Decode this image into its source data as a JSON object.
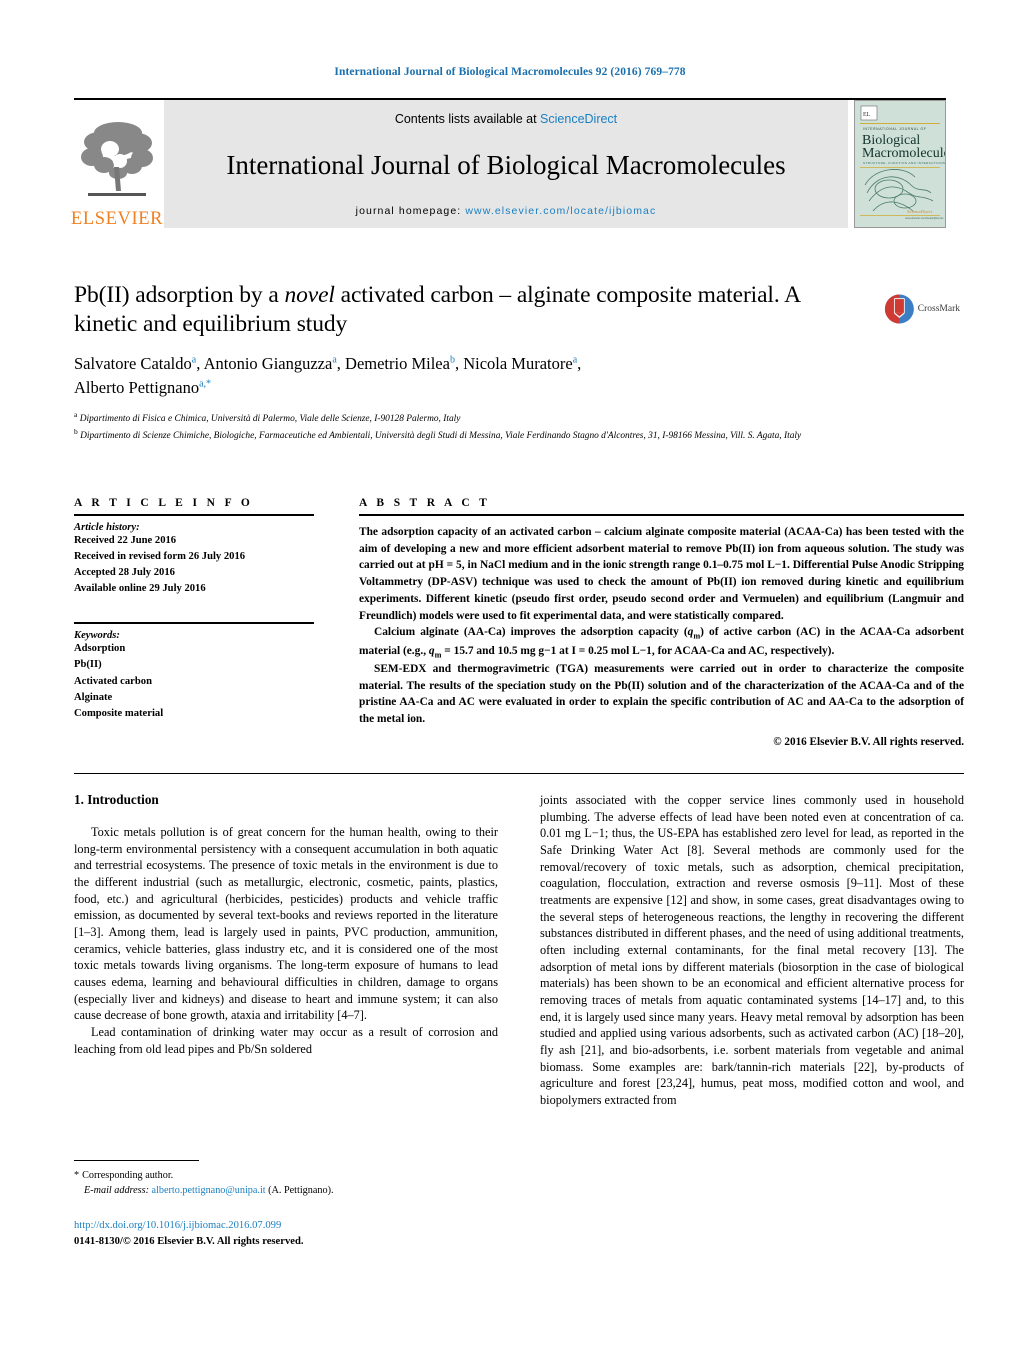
{
  "running_head": "International Journal of Biological Macromolecules 92 (2016) 769–778",
  "masthead": {
    "contents_prefix": "Contents lists available at ",
    "contents_link": "ScienceDirect",
    "journal_title": "International Journal of Biological Macromolecules",
    "homepage_prefix": "journal homepage: ",
    "homepage_url": "www.elsevier.com/locate/ijbiomac",
    "publisher_name": "ELSEVIER",
    "cover_line1": "INTERNATIONAL JOURNAL OF",
    "cover_line2": "Biological",
    "cover_line3": "Macromolecules",
    "cover_line4": "STRUCTURE, FUNCTION AND INTERACTIONS",
    "cover_footer": "ScienceDirect",
    "cover_footer_sub": "www.elsevier.com/locate/ijbiomac"
  },
  "article": {
    "title_part1": "Pb(II) adsorption by a ",
    "title_italic": "novel",
    "title_part2": " activated carbon – alginate composite material. A kinetic and equilibrium study",
    "authors": [
      {
        "name": "Salvatore Cataldo",
        "sup": "a"
      },
      {
        "name": "Antonio Gianguzza",
        "sup": "a"
      },
      {
        "name": "Demetrio Milea",
        "sup": "b"
      },
      {
        "name": "Nicola Muratore",
        "sup": "a"
      },
      {
        "name": "Alberto Pettignano",
        "sup": "a,*"
      }
    ],
    "affiliations": [
      {
        "marker": "a",
        "text": "Dipartimento di Fisica e Chimica, Università di Palermo, Viale delle Scienze, I-90128 Palermo, Italy"
      },
      {
        "marker": "b",
        "text": "Dipartimento di Scienze Chimiche, Biologiche, Farmaceutiche ed Ambientali, Università degli Studi di Messina, Viale Ferdinando Stagno d'Alcontres, 31, I-98166 Messina, Vill. S. Agata, Italy"
      }
    ],
    "crossmark_label": "CrossMark"
  },
  "article_info": {
    "heading": "A R T I C L E    I N F O",
    "history_title": "Article history:",
    "history": [
      "Received 22 June 2016",
      "Received in revised form 26 July 2016",
      "Accepted 28 July 2016",
      "Available online 29 July 2016"
    ],
    "keywords_title": "Keywords:",
    "keywords": [
      "Adsorption",
      "Pb(II)",
      "Activated carbon",
      "Alginate",
      "Composite material"
    ]
  },
  "abstract": {
    "heading": "A B S T R A C T",
    "paragraph1": "The adsorption capacity of an activated carbon – calcium alginate composite material (ACAA-Ca) has been tested with the aim of developing a new and more efficient adsorbent material to remove Pb(II) ion from aqueous solution. The study was carried out at pH = 5, in NaCl medium and in the ionic strength range 0.1–0.75 mol L−1. Differential Pulse Anodic Stripping Voltammetry (DP-ASV) technique was used to check the amount of Pb(II) ion removed during kinetic and equilibrium experiments. Different kinetic (pseudo first order, pseudo second order and Vermuelen) and equilibrium (Langmuir and Freundlich) models were used to fit experimental data, and were statistically compared.",
    "paragraph2_a": "Calcium alginate (AA-Ca) improves the adsorption capacity (",
    "paragraph2_qm": "q",
    "paragraph2_qm_sub": "m",
    "paragraph2_b": ") of active carbon (AC) in the ACAA-Ca adsorbent material (e.g., ",
    "paragraph2_c": " = 15.7 and 10.5 mg g−1 at I = 0.25 mol L−1, for ACAA-Ca and AC, respectively).",
    "paragraph3": "SEM-EDX and thermogravimetric (TGA) measurements were carried out in order to characterize the composite material. The results of the speciation study on the Pb(II) solution and of the characterization of the ACAA-Ca and of the pristine AA-Ca and AC were evaluated in order to explain the specific contribution of AC and AA-Ca to the adsorption of the metal ion.",
    "copyright": "© 2016 Elsevier B.V. All rights reserved."
  },
  "introduction": {
    "heading": "1.  Introduction",
    "left_paragraphs": [
      "Toxic metals pollution is of great concern for the human health, owing to their long-term environmental persistency with a consequent accumulation in both aquatic and terrestrial ecosystems. The presence of toxic metals in the environment is due to the different industrial (such as metallurgic, electronic, cosmetic, paints, plastics, food, etc.) and agricultural (herbicides, pesticides) products and vehicle traffic emission, as documented by several text-books and reviews reported in the literature [1–3]. Among them, lead is largely used in paints, PVC production, ammunition, ceramics, vehicle batteries, glass industry etc, and it is considered one of the most toxic metals towards living organisms. The long-term exposure of humans to lead causes edema, learning and behavioural difficulties in children, damage to organs (especially liver and kidneys) and disease to heart and immune system; it can also cause decrease of bone growth, ataxia and irritability [4–7].",
      "Lead contamination of drinking water may occur as a result of corrosion and leaching from old lead pipes and Pb/Sn soldered"
    ],
    "right_paragraphs": [
      "joints associated with the copper service lines commonly used in household plumbing. The adverse effects of lead have been noted even at concentration of ca. 0.01 mg L−1; thus, the US-EPA has established zero level for lead, as reported in the Safe Drinking Water Act [8]. Several methods are commonly used for the removal/recovery of toxic metals, such as adsorption, chemical precipitation, coagulation, flocculation, extraction and reverse osmosis [9–11]. Most of these treatments are expensive [12] and show, in some cases, great disadvantages owing to the several steps of heterogeneous reactions, the lengthy in recovering the different substances distributed in different phases, and the need of using additional treatments, often including external contaminants, for the final metal recovery [13]. The adsorption of metal ions by different materials (biosorption in the case of biological materials) has been shown to be an economical and efficient alternative process for removing traces of metals from aquatic contaminated systems [14–17] and, to this end, it is largely used since many years. Heavy metal removal by adsorption has been studied and applied using various adsorbents, such as activated carbon (AC) [18–20], fly ash [21], and bio-adsorbents, i.e. sorbent materials from vegetable and animal biomass. Some examples are: bark/tannin-rich materials [22], by-products of agriculture and forest [23,24], humus, peat moss, modified cotton and wool, and biopolymers extracted from"
    ]
  },
  "footer": {
    "corresponding_star": "*",
    "corresponding_label": "Corresponding author.",
    "email_label": "E-mail address:",
    "email": "alberto.pettignano@unipa.it",
    "email_owner": "(A. Pettignano).",
    "doi": "http://dx.doi.org/10.1016/j.ijbiomac.2016.07.099",
    "issn_line": "0141-8130/© 2016 Elsevier B.V. All rights reserved."
  },
  "colors": {
    "link_blue": "#1a7fc1",
    "head_blue": "#1a6fad",
    "elsevier_orange": "#f08020",
    "masthead_grey": "#e6e6e6",
    "cover_teal": "#7fb8a8"
  }
}
